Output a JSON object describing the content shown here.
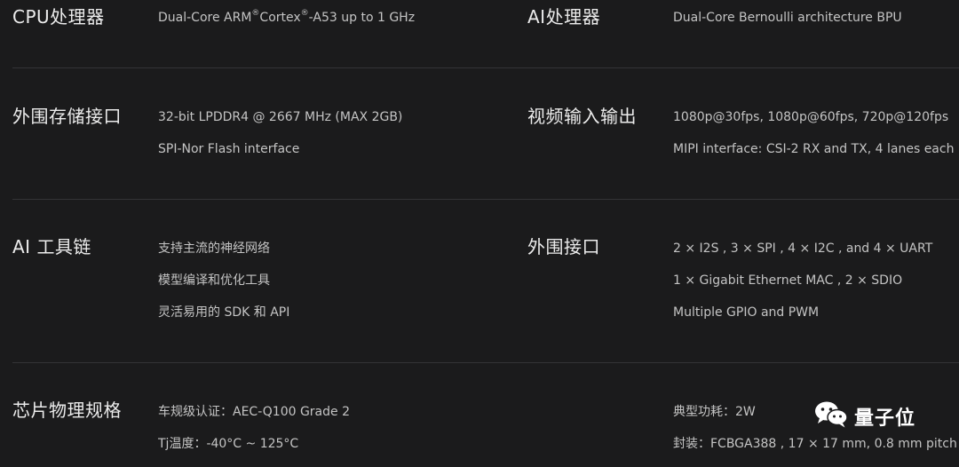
{
  "specs": {
    "cpu": {
      "title": "CPU处理器",
      "line_parts": [
        "Dual-Core ARM",
        "®",
        "Cortex",
        "®",
        "-A53 up to 1 GHz"
      ]
    },
    "ai_processor": {
      "title": "AI处理器",
      "lines": [
        "Dual-Core Bernoulli architecture BPU"
      ]
    },
    "peripheral_storage": {
      "title": "外围存储接口",
      "lines": [
        "32-bit LPDDR4 @ 2667 MHz (MAX 2GB)",
        "SPI-Nor Flash interface"
      ]
    },
    "video_io": {
      "title": "视频输入输出",
      "lines": [
        "1080p@30fps, 1080p@60fps, 720p@120fps",
        "MIPI interface: CSI-2 RX and TX, 4 lanes each"
      ]
    },
    "ai_toolchain": {
      "title": "AI 工具链",
      "lines": [
        "支持主流的神经网络",
        "模型编译和优化工具",
        "灵活易用的 SDK 和 API"
      ]
    },
    "peripheral_interfaces": {
      "title": "外围接口",
      "lines": [
        "2 × I2S , 3 × SPI , 4 × I2C , and 4 × UART",
        "1 × Gigabit Ethernet MAC , 2 × SDIO",
        "Multiple GPIO and PWM"
      ]
    },
    "chip_physical": {
      "title": "芯片物理规格",
      "lines": [
        "车规级认证：AEC-Q100 Grade 2",
        "Tj温度：-40°C ~ 125°C"
      ]
    },
    "chip_power": {
      "lines": [
        "典型功耗：2W",
        "封装：FCBGA388 , 17 × 17 mm, 0.8 mm pitch"
      ]
    }
  },
  "watermark": {
    "text": "量子位",
    "icon": "wechat-icon"
  },
  "colors": {
    "background": "#1b1b1c",
    "divider": "#343436",
    "title": "#ececec",
    "text": "#c4c4c4"
  }
}
